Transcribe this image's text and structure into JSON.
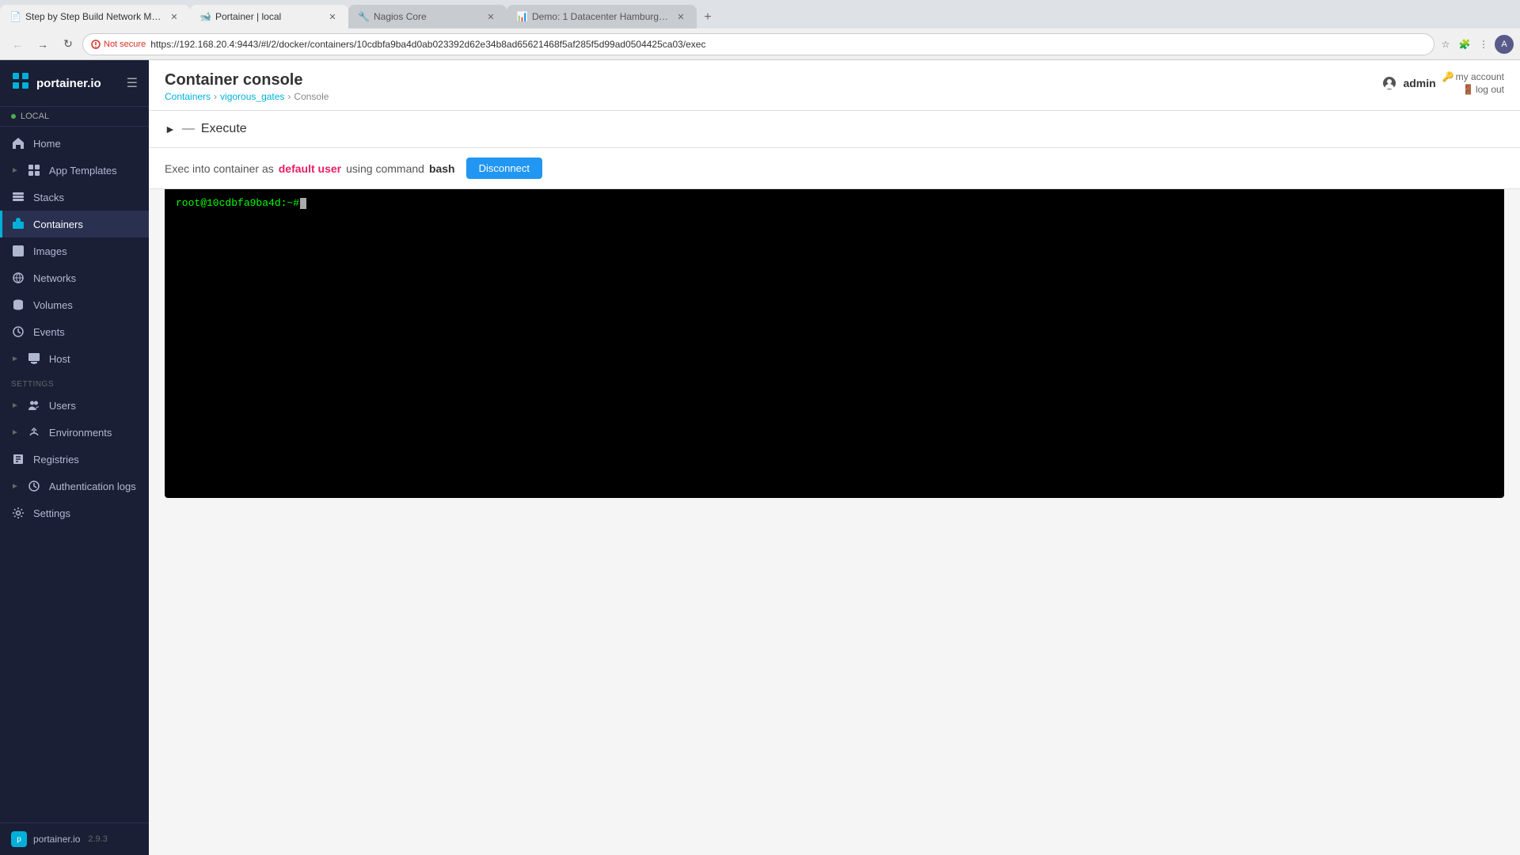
{
  "browser": {
    "tabs": [
      {
        "id": "tab1",
        "title": "Step by Step Build Network Mo...",
        "favicon": "📄",
        "active": true
      },
      {
        "id": "tab2",
        "title": "Portainer | local",
        "favicon": "🐋",
        "active": true
      },
      {
        "id": "tab3",
        "title": "Nagios Core",
        "favicon": "🔧",
        "active": false
      },
      {
        "id": "tab4",
        "title": "Demo: 1 Datacenter Hamburg (...",
        "favicon": "📊",
        "active": false
      }
    ],
    "url": "https://192.168.20.4:9443/#l/2/docker/containers/10cdbfa9ba4d0ab023392d62e34b8ad65621468f5af285f5d99ad0504425ca03/exec",
    "security_label": "Not secure"
  },
  "sidebar": {
    "logo_text": "portainer.io",
    "env_label": "LOCAL",
    "nav_items": [
      {
        "label": "Home",
        "icon": "🏠",
        "section": null,
        "active": false,
        "has_chevron": false
      },
      {
        "label": "App Templates",
        "icon": "📋",
        "section": null,
        "active": false,
        "has_chevron": true
      },
      {
        "label": "Stacks",
        "icon": "📦",
        "section": null,
        "active": false,
        "has_chevron": false
      },
      {
        "label": "Containers",
        "icon": "🐳",
        "section": null,
        "active": true,
        "has_chevron": false
      },
      {
        "label": "Images",
        "icon": "🖼",
        "section": null,
        "active": false,
        "has_chevron": false
      },
      {
        "label": "Networks",
        "icon": "🌐",
        "section": null,
        "active": false,
        "has_chevron": false
      },
      {
        "label": "Volumes",
        "icon": "💾",
        "section": null,
        "active": false,
        "has_chevron": false
      },
      {
        "label": "Events",
        "icon": "🕐",
        "section": null,
        "active": false,
        "has_chevron": false
      },
      {
        "label": "Host",
        "icon": "🖥",
        "section": null,
        "active": false,
        "has_chevron": true
      }
    ],
    "settings_section": "SETTINGS",
    "settings_items": [
      {
        "label": "Users",
        "icon": "👥",
        "active": false,
        "has_chevron": true
      },
      {
        "label": "Environments",
        "icon": "🌍",
        "active": false,
        "has_chevron": true
      },
      {
        "label": "Registries",
        "icon": "📁",
        "active": false,
        "has_chevron": false
      },
      {
        "label": "Authentication logs",
        "icon": "🕐",
        "active": false,
        "has_chevron": true
      },
      {
        "label": "Settings",
        "icon": "⚙",
        "active": false,
        "has_chevron": false
      }
    ],
    "footer_version": "2.9.3"
  },
  "header": {
    "title": "Container console",
    "breadcrumb": [
      "Containers",
      "vigorous_gates",
      "Console"
    ],
    "admin_label": "admin",
    "my_account_link": "my account",
    "log_out_link": "log out"
  },
  "execute_section": {
    "title": "Execute"
  },
  "console_info": {
    "prefix": "Exec into container as",
    "user": "default user",
    "middle": "using command",
    "command": "bash",
    "disconnect_label": "Disconnect"
  },
  "terminal": {
    "prompt": "root@10cdbfa9ba4d:~#"
  }
}
